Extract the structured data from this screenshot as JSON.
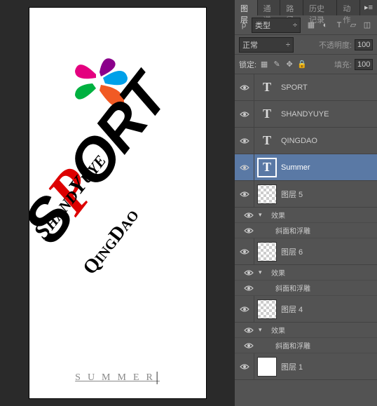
{
  "tabs": {
    "layers": "图层",
    "channels": "通道",
    "paths": "路径",
    "history": "历史记录",
    "actions": "动作"
  },
  "kind_label": "类型",
  "blend_mode": "正常",
  "opacity_label": "不透明度:",
  "opacity_value": "100",
  "lock_label": "锁定:",
  "fill_label": "填充:",
  "fill_value": "100",
  "fx_label": "效果",
  "bevel_label": "斜面和浮雕",
  "layers": [
    {
      "name": "SPORT",
      "type": "text"
    },
    {
      "name": "SHANDYUYE",
      "type": "text"
    },
    {
      "name": "QINGDAO",
      "type": "text"
    },
    {
      "name": "Summer",
      "type": "text",
      "selected": true
    },
    {
      "name": "图层 5",
      "type": "px",
      "fx": true
    },
    {
      "name": "图层 6",
      "type": "px",
      "fx": true
    },
    {
      "name": "图层 4",
      "type": "px",
      "fx": true
    },
    {
      "name": "图层 1",
      "type": "white"
    }
  ],
  "canvas": {
    "sport": "SPORT",
    "shandy": "ShandYuye",
    "qingdao": "QingDao",
    "summer": "SUMMER"
  }
}
